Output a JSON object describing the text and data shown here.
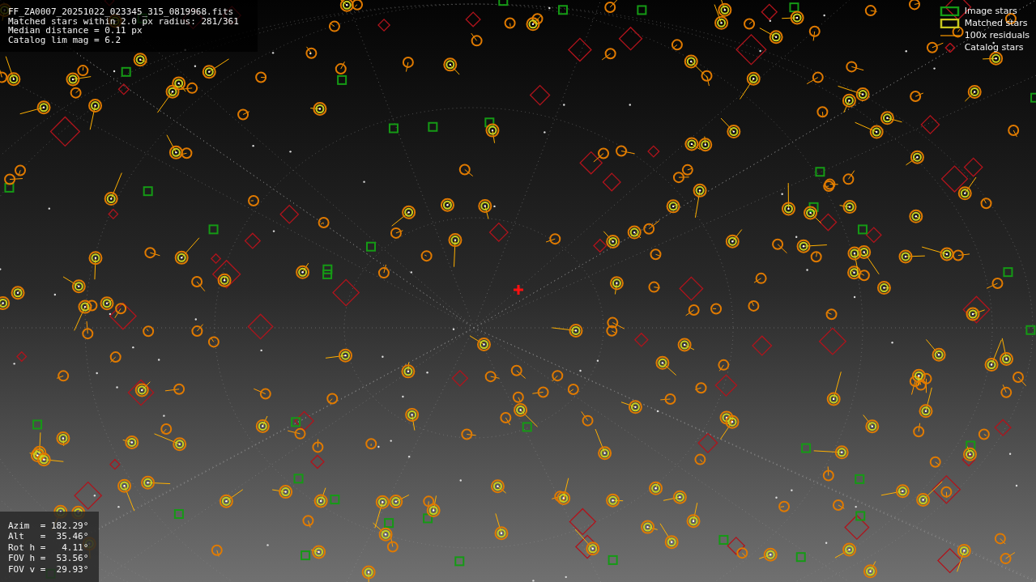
{
  "info": [
    "FF_ZA0007_20251022_023345_315_0819968.fits",
    "Matched stars within 2.0 px radius: 281/361",
    "Median distance = 0.11 px",
    "Catalog lim mag = 6.2"
  ],
  "legend": [
    {
      "kind": "image",
      "label": "Image stars"
    },
    {
      "kind": "matched",
      "label": "Matched stars"
    },
    {
      "kind": "residual",
      "label": "100x residuals"
    },
    {
      "kind": "catalog",
      "label": "Catalog stars"
    }
  ],
  "pointing": [
    "Azim  = 182.29°",
    "Alt   =  35.46°",
    "Rot h =   4.11°",
    "FOV h =  53.56°",
    "FOV v =  29.93°"
  ]
}
